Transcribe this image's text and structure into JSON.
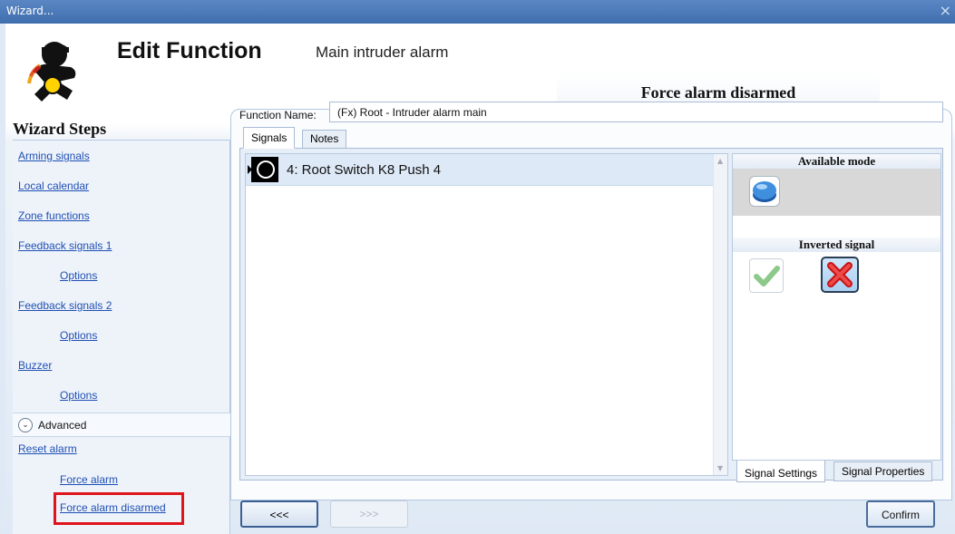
{
  "window": {
    "title": "Wizard...",
    "close_glyph": "×"
  },
  "header": {
    "title": "Edit Function",
    "subtitle": "Main intruder alarm",
    "logo_icon": "intruder-alarm-logo",
    "current_step": "Force alarm disarmed"
  },
  "sidebar": {
    "title": "Wizard Steps",
    "items": [
      {
        "label": "Arming signals",
        "sub": false
      },
      {
        "label": "Local calendar",
        "sub": false
      },
      {
        "label": "Zone functions",
        "sub": false
      },
      {
        "label": "Feedback signals 1",
        "sub": false
      },
      {
        "label": "Options",
        "sub": true
      },
      {
        "label": "Feedback signals 2",
        "sub": false
      },
      {
        "label": "Options",
        "sub": true
      },
      {
        "label": "Buzzer",
        "sub": false
      },
      {
        "label": "Options",
        "sub": true
      }
    ],
    "advanced_label": "Advanced",
    "advanced_items": [
      {
        "label": "Reset alarm",
        "sub": false
      },
      {
        "label": "Force alarm",
        "sub": true
      },
      {
        "label": "Force alarm disarmed",
        "sub": true,
        "selected": true
      }
    ]
  },
  "form": {
    "function_name_label": "Function Name:",
    "function_name_value": "(Fx) Root - Intruder alarm main"
  },
  "tabs": {
    "signals": "Signals",
    "notes": "Notes"
  },
  "signal_list": [
    {
      "label": "4: Root Switch K8 Push 4",
      "icon": "push-button-icon"
    }
  ],
  "right_pane": {
    "available_mode_title": "Available mode",
    "inverted_signal_title": "Inverted signal",
    "mode_icon": "blue-push-button-icon",
    "check_icon": "green-check-icon",
    "cross_icon": "red-cross-icon"
  },
  "bottom_tabs": {
    "signal_settings": "Signal Settings",
    "signal_properties": "Signal Properties"
  },
  "buttons": {
    "prev": "<<<",
    "next": ">>>",
    "confirm": "Confirm"
  }
}
